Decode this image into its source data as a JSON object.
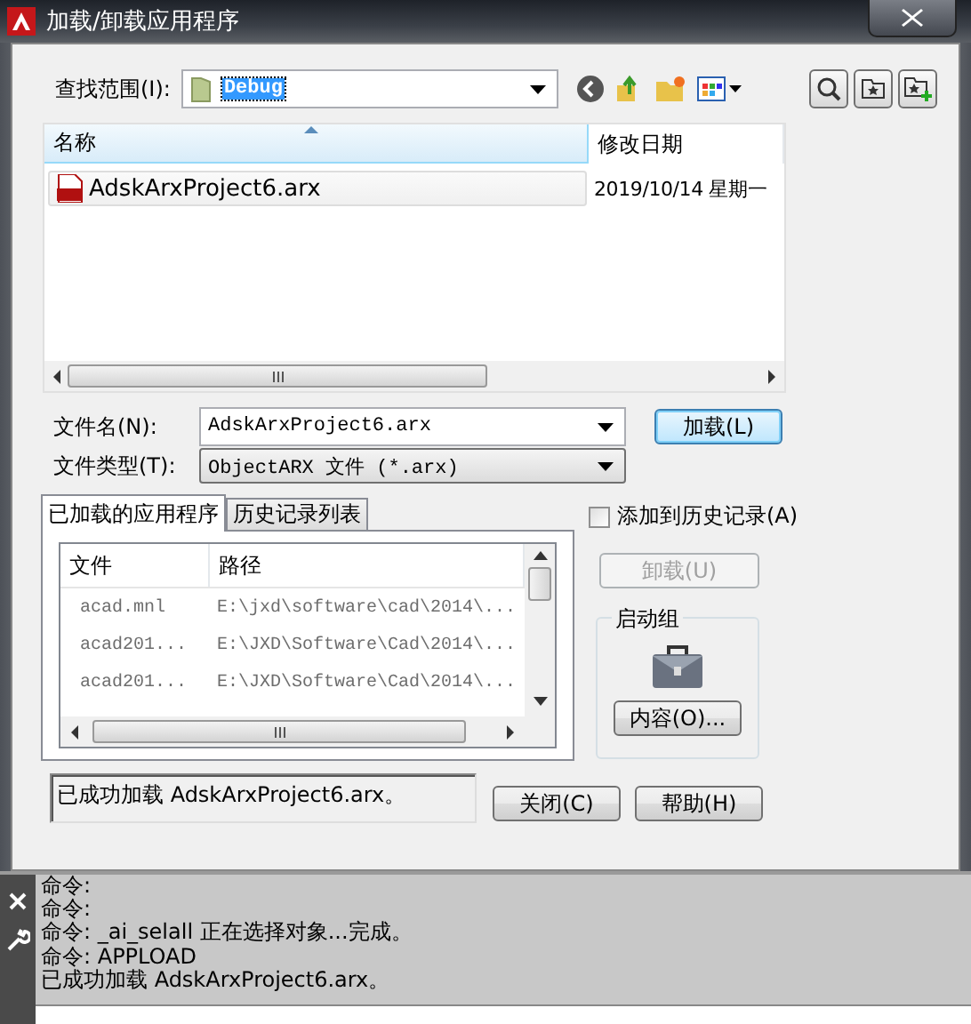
{
  "window": {
    "title": "加载/卸载应用程序"
  },
  "look_in": {
    "label": "查找范围(I):",
    "value": "Debug"
  },
  "file_list": {
    "columns": [
      "名称",
      "修改日期"
    ],
    "rows": [
      {
        "name": "AdskArxProject6.arx",
        "modified": "2019/10/14 星期一",
        "selected": false
      }
    ]
  },
  "file_name": {
    "label": "文件名(N):",
    "value": "AdskArxProject6.arx"
  },
  "file_type": {
    "label": "文件类型(T):",
    "value": "ObjectARX 文件 (*.arx)"
  },
  "load_button": "加载(L)",
  "tabs": [
    {
      "label": "已加载的应用程序",
      "selected": true
    },
    {
      "label": "历史记录列表",
      "selected": false
    }
  ],
  "add_to_history": {
    "label": "添加到历史记录(A)",
    "checked": false
  },
  "loaded_apps": {
    "columns": [
      "文件",
      "路径"
    ],
    "rows": [
      {
        "file": "acad.mnl",
        "path": "E:\\jxd\\software\\cad\\2014\\..."
      },
      {
        "file": "acad201...",
        "path": "E:\\JXD\\Software\\Cad\\2014\\..."
      },
      {
        "file": "acad201...",
        "path": "E:\\JXD\\Software\\Cad\\2014\\..."
      }
    ]
  },
  "unload_button": {
    "label": "卸载(U)",
    "disabled": true
  },
  "startup_suite": {
    "title": "启动组",
    "button": "内容(O)..."
  },
  "status_message": "已成功加载 AdskArxProject6.arx。",
  "close_button": "关闭(C)",
  "help_button": "帮助(H)",
  "command_lines": [
    "命令:",
    "命令:",
    "命令: _ai_selall 正在选择对象...完成。",
    "命令: APPLOAD",
    "已成功加载 AdskArxProject6.arx。"
  ]
}
